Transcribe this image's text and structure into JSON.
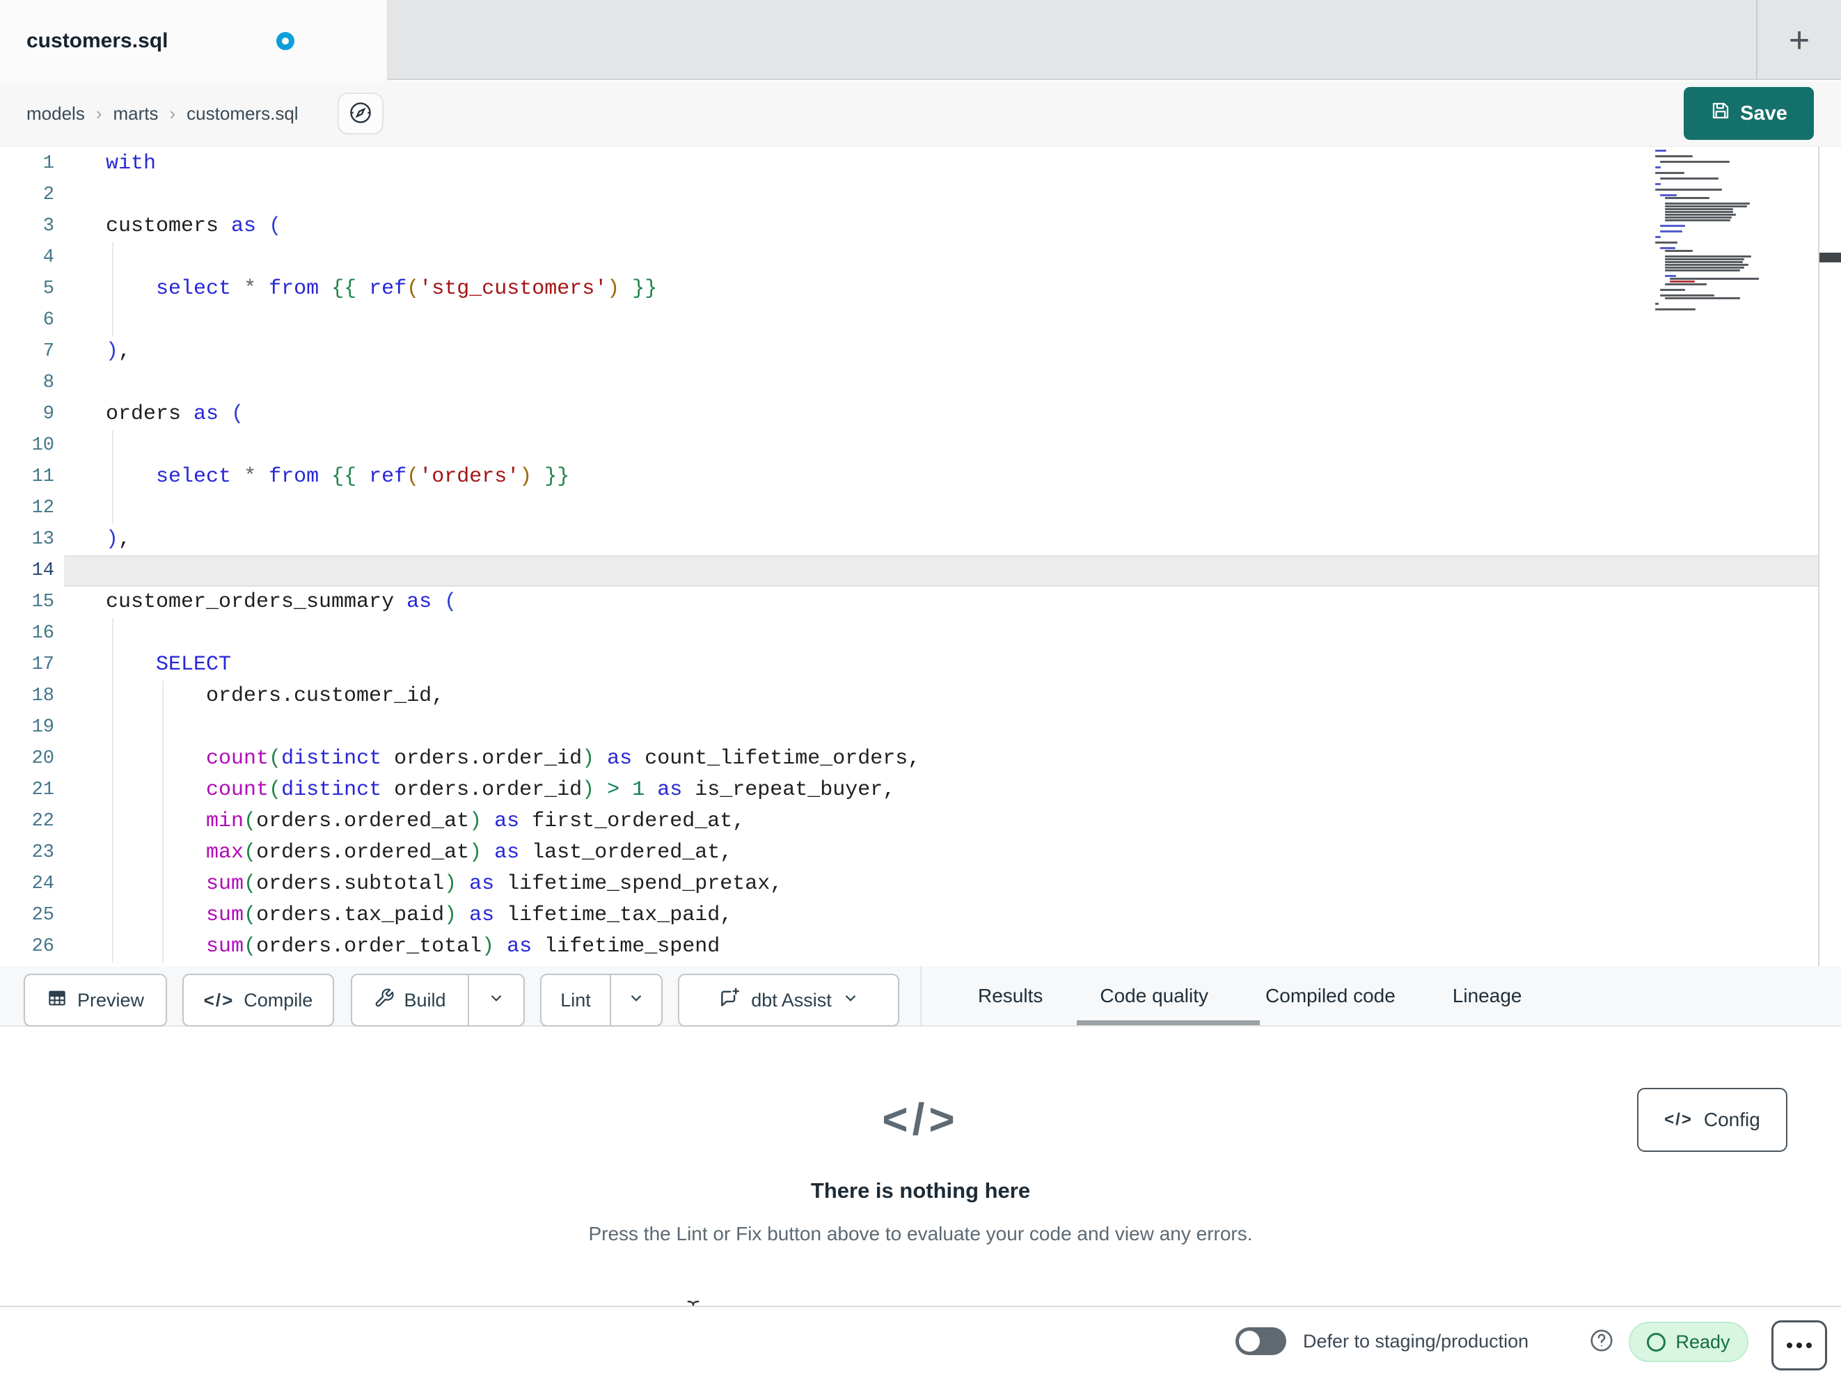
{
  "window": {
    "tab_title": "customers.sql",
    "new_tab_button": "+"
  },
  "breadcrumb": {
    "items": [
      "models",
      "marts",
      "customers.sql"
    ],
    "separator": "›"
  },
  "header": {
    "save_label": "Save"
  },
  "editor": {
    "active_line": 14,
    "lines": [
      {
        "n": 1,
        "g": 0,
        "t": [
          [
            "with",
            "k"
          ]
        ]
      },
      {
        "n": 2,
        "g": 0,
        "t": []
      },
      {
        "n": 3,
        "g": 0,
        "t": [
          [
            "customers ",
            "t"
          ],
          [
            "as",
            "k"
          ],
          [
            " ",
            "t"
          ],
          [
            "(",
            "b1"
          ]
        ]
      },
      {
        "n": 4,
        "g": 1,
        "t": []
      },
      {
        "n": 5,
        "g": 1,
        "t": [
          [
            "    ",
            "t"
          ],
          [
            "select",
            "k"
          ],
          [
            " ",
            "t"
          ],
          [
            "*",
            "o"
          ],
          [
            " ",
            "t"
          ],
          [
            "from",
            "k"
          ],
          [
            " ",
            "t"
          ],
          [
            "{{",
            "b2"
          ],
          [
            " ",
            "t"
          ],
          [
            "ref",
            "k"
          ],
          [
            "(",
            "b3"
          ],
          [
            "'stg_customers'",
            "s"
          ],
          [
            ")",
            "b3"
          ],
          [
            " ",
            "t"
          ],
          [
            "}}",
            "b2"
          ]
        ]
      },
      {
        "n": 6,
        "g": 1,
        "t": []
      },
      {
        "n": 7,
        "g": 0,
        "t": [
          [
            ")",
            "b1"
          ],
          [
            ",",
            "t"
          ]
        ]
      },
      {
        "n": 8,
        "g": 0,
        "t": []
      },
      {
        "n": 9,
        "g": 0,
        "t": [
          [
            "orders ",
            "t"
          ],
          [
            "as",
            "k"
          ],
          [
            " ",
            "t"
          ],
          [
            "(",
            "b1"
          ]
        ]
      },
      {
        "n": 10,
        "g": 1,
        "t": []
      },
      {
        "n": 11,
        "g": 1,
        "t": [
          [
            "    ",
            "t"
          ],
          [
            "select",
            "k"
          ],
          [
            " ",
            "t"
          ],
          [
            "*",
            "o"
          ],
          [
            " ",
            "t"
          ],
          [
            "from",
            "k"
          ],
          [
            " ",
            "t"
          ],
          [
            "{{",
            "b2"
          ],
          [
            " ",
            "t"
          ],
          [
            "ref",
            "k"
          ],
          [
            "(",
            "b3"
          ],
          [
            "'orders'",
            "s"
          ],
          [
            ")",
            "b3"
          ],
          [
            " ",
            "t"
          ],
          [
            "}}",
            "b2"
          ]
        ]
      },
      {
        "n": 12,
        "g": 1,
        "t": []
      },
      {
        "n": 13,
        "g": 0,
        "t": [
          [
            ")",
            "b1"
          ],
          [
            ",",
            "t"
          ]
        ]
      },
      {
        "n": 14,
        "g": 0,
        "t": []
      },
      {
        "n": 15,
        "g": 0,
        "t": [
          [
            "customer_orders_summary ",
            "t"
          ],
          [
            "as",
            "k"
          ],
          [
            " ",
            "t"
          ],
          [
            "(",
            "b1"
          ]
        ]
      },
      {
        "n": 16,
        "g": 1,
        "t": []
      },
      {
        "n": 17,
        "g": 1,
        "t": [
          [
            "    ",
            "t"
          ],
          [
            "SELECT",
            "k"
          ]
        ]
      },
      {
        "n": 18,
        "g": 2,
        "t": [
          [
            "        orders.customer_id,",
            "t"
          ]
        ]
      },
      {
        "n": 19,
        "g": 2,
        "t": []
      },
      {
        "n": 20,
        "g": 2,
        "t": [
          [
            "        ",
            "t"
          ],
          [
            "count",
            "f"
          ],
          [
            "(",
            "b2"
          ],
          [
            "distinct",
            "k"
          ],
          [
            " orders.order_id",
            "t"
          ],
          [
            ")",
            "b2"
          ],
          [
            " ",
            "t"
          ],
          [
            "as",
            "k"
          ],
          [
            " count_lifetime_orders,",
            "t"
          ]
        ]
      },
      {
        "n": 21,
        "g": 2,
        "t": [
          [
            "        ",
            "t"
          ],
          [
            "count",
            "f"
          ],
          [
            "(",
            "b2"
          ],
          [
            "distinct",
            "k"
          ],
          [
            " orders.order_id",
            "t"
          ],
          [
            ")",
            "b2"
          ],
          [
            " ",
            "t"
          ],
          [
            ">",
            "n"
          ],
          [
            " ",
            "t"
          ],
          [
            "1",
            "n"
          ],
          [
            " ",
            "t"
          ],
          [
            "as",
            "k"
          ],
          [
            " is_repeat_buyer,",
            "t"
          ]
        ]
      },
      {
        "n": 22,
        "g": 2,
        "t": [
          [
            "        ",
            "t"
          ],
          [
            "min",
            "f"
          ],
          [
            "(",
            "b2"
          ],
          [
            "orders.ordered_at",
            "t"
          ],
          [
            ")",
            "b2"
          ],
          [
            " ",
            "t"
          ],
          [
            "as",
            "k"
          ],
          [
            " first_ordered_at,",
            "t"
          ]
        ]
      },
      {
        "n": 23,
        "g": 2,
        "t": [
          [
            "        ",
            "t"
          ],
          [
            "max",
            "f"
          ],
          [
            "(",
            "b2"
          ],
          [
            "orders.ordered_at",
            "t"
          ],
          [
            ")",
            "b2"
          ],
          [
            " ",
            "t"
          ],
          [
            "as",
            "k"
          ],
          [
            " last_ordered_at,",
            "t"
          ]
        ]
      },
      {
        "n": 24,
        "g": 2,
        "t": [
          [
            "        ",
            "t"
          ],
          [
            "sum",
            "f"
          ],
          [
            "(",
            "b2"
          ],
          [
            "orders.subtotal",
            "t"
          ],
          [
            ")",
            "b2"
          ],
          [
            " ",
            "t"
          ],
          [
            "as",
            "k"
          ],
          [
            " lifetime_spend_pretax,",
            "t"
          ]
        ]
      },
      {
        "n": 25,
        "g": 2,
        "t": [
          [
            "        ",
            "t"
          ],
          [
            "sum",
            "f"
          ],
          [
            "(",
            "b2"
          ],
          [
            "orders.tax_paid",
            "t"
          ],
          [
            ")",
            "b2"
          ],
          [
            " ",
            "t"
          ],
          [
            "as",
            "k"
          ],
          [
            " lifetime_tax_paid,",
            "t"
          ]
        ]
      },
      {
        "n": 26,
        "g": 2,
        "t": [
          [
            "        ",
            "t"
          ],
          [
            "sum",
            "f"
          ],
          [
            "(",
            "b2"
          ],
          [
            "orders.order_total",
            "t"
          ],
          [
            ")",
            "b2"
          ],
          [
            " ",
            "t"
          ],
          [
            "as",
            "k"
          ],
          [
            " lifetime_spend",
            "t"
          ]
        ]
      }
    ]
  },
  "minimap": {
    "bars": [
      [
        1,
        0,
        16,
        "b"
      ],
      [
        3,
        0,
        54,
        "d"
      ],
      [
        5,
        1,
        100,
        "d"
      ],
      [
        7,
        0,
        8,
        "b"
      ],
      [
        9,
        0,
        42,
        "d"
      ],
      [
        11,
        1,
        84,
        "d"
      ],
      [
        13,
        0,
        8,
        "b"
      ],
      [
        15,
        0,
        96,
        "d"
      ],
      [
        17,
        1,
        24,
        "b"
      ],
      [
        18,
        2,
        64,
        "d"
      ],
      [
        20,
        2,
        122,
        "d"
      ],
      [
        21,
        2,
        118,
        "d"
      ],
      [
        22,
        2,
        98,
        "d"
      ],
      [
        23,
        2,
        98,
        "d"
      ],
      [
        24,
        2,
        102,
        "d"
      ],
      [
        25,
        2,
        96,
        "d"
      ],
      [
        26,
        2,
        94,
        "d"
      ],
      [
        28,
        1,
        36,
        "b"
      ],
      [
        30,
        1,
        32,
        "b"
      ],
      [
        32,
        0,
        8,
        "b"
      ],
      [
        34,
        0,
        32,
        "d"
      ],
      [
        36,
        1,
        22,
        "b"
      ],
      [
        37,
        2,
        40,
        "d"
      ],
      [
        39,
        2,
        124,
        "d"
      ],
      [
        40,
        2,
        114,
        "d"
      ],
      [
        41,
        2,
        112,
        "d"
      ],
      [
        42,
        2,
        120,
        "d"
      ],
      [
        43,
        2,
        114,
        "d"
      ],
      [
        44,
        2,
        108,
        "d"
      ],
      [
        46,
        2,
        16,
        "b"
      ],
      [
        47,
        3,
        128,
        "d"
      ],
      [
        48,
        3,
        36,
        "r"
      ],
      [
        49,
        2,
        60,
        "d"
      ],
      [
        51,
        1,
        36,
        "d"
      ],
      [
        53,
        1,
        78,
        "d"
      ],
      [
        54,
        2,
        108,
        "d"
      ],
      [
        56,
        0,
        5,
        "d"
      ],
      [
        58,
        0,
        58,
        "d"
      ]
    ]
  },
  "toolbar": {
    "preview_label": "Preview",
    "compile_label": "Compile",
    "build_label": "Build",
    "lint_label": "Lint",
    "assist_label": "dbt Assist"
  },
  "panel": {
    "tabs": [
      {
        "label": "Results",
        "active": false
      },
      {
        "label": "Code quality",
        "active": true
      },
      {
        "label": "Compiled code",
        "active": false
      },
      {
        "label": "Lineage",
        "active": false
      }
    ],
    "code_glyph": "</>",
    "empty_title": "There is nothing here",
    "empty_subtitle": "Press the Lint or Fix button above to evaluate your code and view any errors.",
    "config_label": "Config"
  },
  "status_bar": {
    "defer_label": "Defer to staging/production",
    "ready_label": "Ready"
  },
  "colors": {
    "accent_teal": "#14706a",
    "unsaved_dot": "#0d9fd9",
    "ready_bg": "#d9f6e2",
    "ready_text": "#156c44",
    "keyword": "#2727d8",
    "function": "#b10bb8",
    "string": "#a31515",
    "bracket_level1": "#2b3cd0",
    "bracket_level2": "#1e8449",
    "bracket_level3": "#9a6700",
    "number": "#0c7d5a",
    "gutter": "#43768a",
    "active_line_bg": "#ededee",
    "tab_underline": "#9aa1a7"
  }
}
